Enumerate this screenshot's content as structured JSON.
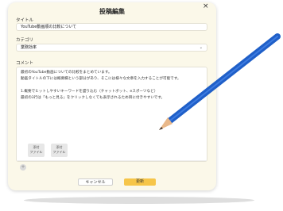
{
  "modal": {
    "title": "投稿編集",
    "close_symbol": "×"
  },
  "title_field": {
    "label": "タイトル",
    "value": "YouTube動画順の比較について"
  },
  "category_field": {
    "label": "カテゴリ",
    "value": "業務効率"
  },
  "comment_field": {
    "label": "コメント",
    "lines": [
      "最初のYouTube動画についての比較をまとめています。",
      "動画タイトルの下には概要欄という部分があり、そこには様々な文章を入力することが可能です。",
      "",
      "1.概要でヒットしやすいキーワードを盛り込む（チャットボット、eスポーツなど）",
      "最初の3行は「もっと見る」をクリックしなくても表示されるため目に付きやすいです。"
    ],
    "attachments": [
      {
        "line1": "添付",
        "line2": "ファイル"
      },
      {
        "line1": "添付",
        "line2": "ファイル"
      }
    ]
  },
  "add_symbol": "+",
  "buttons": {
    "cancel": "キャンセル",
    "update": "更新"
  },
  "colors": {
    "modal_background": "#fbf8e9",
    "update_button": "#f6c549",
    "pen_body": "#1f5fc8"
  },
  "icons": [
    "close-icon",
    "chevron-down-icon",
    "add-icon",
    "pen-illustration"
  ]
}
